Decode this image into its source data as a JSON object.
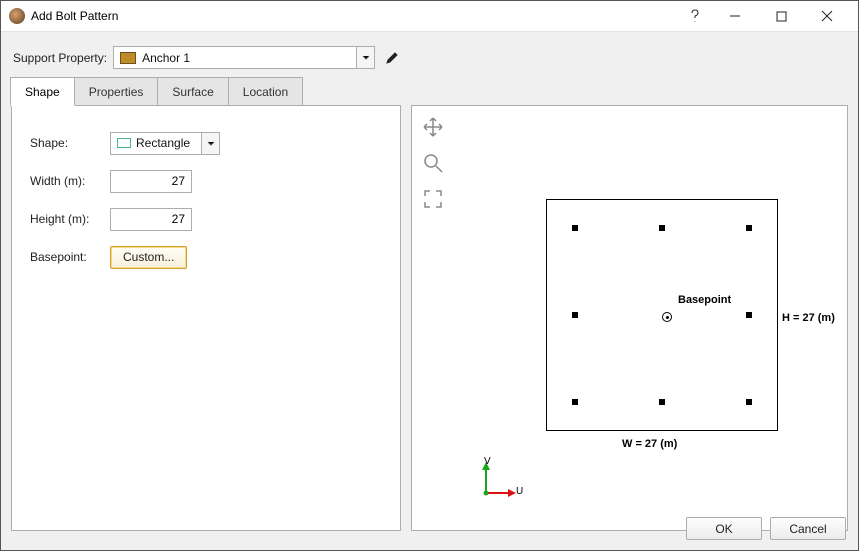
{
  "window": {
    "title": "Add Bolt Pattern"
  },
  "support": {
    "label": "Support Property:",
    "value": "Anchor 1",
    "swatch_color": "#c08a2a"
  },
  "tabs": [
    {
      "label": "Shape",
      "active": true
    },
    {
      "label": "Properties",
      "active": false
    },
    {
      "label": "Surface",
      "active": false
    },
    {
      "label": "Location",
      "active": false
    }
  ],
  "form": {
    "shape_label": "Shape:",
    "shape_value": "Rectangle",
    "width_label": "Width (m):",
    "width_value": "27",
    "height_label": "Height (m):",
    "height_value": "27",
    "basepoint_label": "Basepoint:",
    "basepoint_button": "Custom..."
  },
  "preview": {
    "basepoint_label": "Basepoint",
    "dim_w": "W = 27 (m)",
    "dim_h": "H = 27 (m)",
    "axis_u": "U",
    "axis_v": "V"
  },
  "buttons": {
    "ok": "OK",
    "cancel": "Cancel"
  }
}
